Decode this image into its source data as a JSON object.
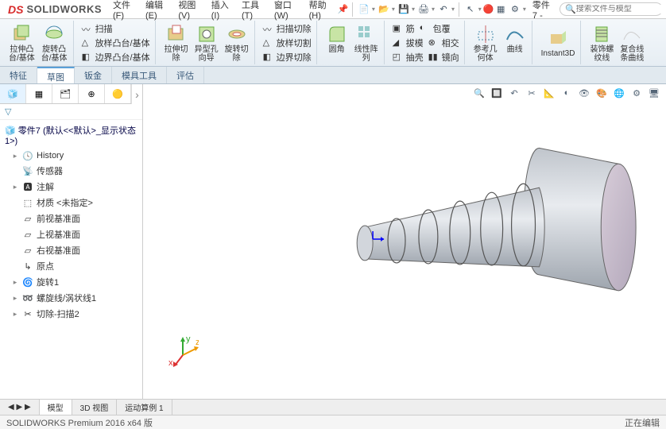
{
  "brand": {
    "ds": "DS",
    "name": "SOLIDWORKS"
  },
  "menus": [
    {
      "label": "文件(F)"
    },
    {
      "label": "编辑(E)"
    },
    {
      "label": "视图(V)"
    },
    {
      "label": "插入(I)"
    },
    {
      "label": "工具(T)"
    },
    {
      "label": "窗口(W)"
    },
    {
      "label": "帮助(H)"
    }
  ],
  "title_part": "零件7 -",
  "search_placeholder": "搜索文件与模型",
  "ribbon": {
    "extrude": "拉伸凸\n台/基体",
    "revolve": "旋转凸\n台/基体",
    "sweep": "扫描",
    "loft": "放样凸台/基体",
    "boundary": "边界凸台/基体",
    "cut_extrude": "拉伸切\n除",
    "hole": "异型孔\n向导",
    "cut_revolve": "旋转切\n除",
    "cut_sweep": "扫描切除",
    "cut_loft": "放样切割",
    "cut_boundary": "边界切除",
    "fillet": "圆角",
    "linear_pattern": "线性阵\n列",
    "rib": "筋",
    "draft": "拔模",
    "shell": "抽壳",
    "wrap": "包覆",
    "intersect": "相交",
    "mirror": "镜向",
    "ref_geom": "参考几\n何体",
    "curves": "曲线",
    "instant3d": "Instant3D",
    "thread": "装饰螺\n纹线",
    "composite": "复合线\n条曲线"
  },
  "tabs": [
    {
      "label": "特征",
      "active": false
    },
    {
      "label": "草图",
      "active": true
    },
    {
      "label": "钣金",
      "active": false
    },
    {
      "label": "模具工具",
      "active": false
    },
    {
      "label": "评估",
      "active": false
    }
  ],
  "tree_root": "零件7 (默认<<默认>_显示状态 1>)",
  "tree": [
    {
      "icon": "history",
      "label": "History",
      "arrow": "▸"
    },
    {
      "icon": "sensor",
      "label": "传感器",
      "arrow": ""
    },
    {
      "icon": "annot",
      "label": "注解",
      "arrow": "▸"
    },
    {
      "icon": "material",
      "label": "材质 <未指定>",
      "arrow": ""
    },
    {
      "icon": "plane",
      "label": "前视基准面",
      "arrow": ""
    },
    {
      "icon": "plane",
      "label": "上视基准面",
      "arrow": ""
    },
    {
      "icon": "plane",
      "label": "右视基准面",
      "arrow": ""
    },
    {
      "icon": "origin",
      "label": "原点",
      "arrow": ""
    },
    {
      "icon": "feature",
      "label": "旋转1",
      "arrow": "▸"
    },
    {
      "icon": "helix",
      "label": "螺旋线/涡状线1",
      "arrow": "▸"
    },
    {
      "icon": "cut",
      "label": "切除-扫描2",
      "arrow": "▸"
    }
  ],
  "bottom_tabs": [
    {
      "label": "模型",
      "active": true
    },
    {
      "label": "3D 视图",
      "active": false
    },
    {
      "label": "运动算例 1",
      "active": false
    }
  ],
  "status_left": "SOLIDWORKS Premium 2016 x64 版",
  "status_right": "正在编辑"
}
